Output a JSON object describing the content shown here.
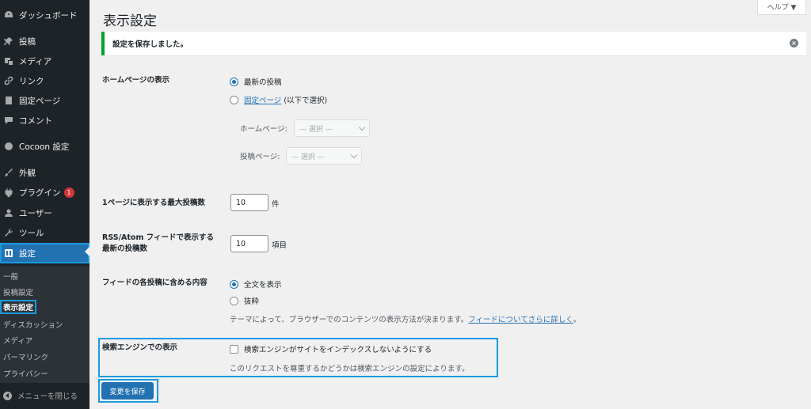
{
  "sidebar": {
    "items": [
      {
        "label": "ダッシュボード",
        "icon": "dashboard-icon"
      },
      {
        "label": "投稿",
        "icon": "pin-icon"
      },
      {
        "label": "メディア",
        "icon": "media-icon"
      },
      {
        "label": "リンク",
        "icon": "link-icon"
      },
      {
        "label": "固定ページ",
        "icon": "page-icon"
      },
      {
        "label": "コメント",
        "icon": "comment-icon"
      },
      {
        "label": "Cocoon 設定",
        "icon": "circle-icon"
      },
      {
        "label": "外観",
        "icon": "brush-icon"
      },
      {
        "label": "プラグイン",
        "icon": "plugin-icon",
        "badge": "1"
      },
      {
        "label": "ユーザー",
        "icon": "user-icon"
      },
      {
        "label": "ツール",
        "icon": "wrench-icon"
      },
      {
        "label": "設定",
        "icon": "settings-icon"
      }
    ],
    "submenu": [
      "一般",
      "投稿設定",
      "表示設定",
      "ディスカッション",
      "メディア",
      "パーマリンク",
      "プライバシー"
    ],
    "collapse_label": "メニューを閉じる"
  },
  "help_tab": "ヘルプ ▼",
  "page_title": "表示設定",
  "notice": {
    "text": "設定を保存しました。",
    "color": "#00a32a"
  },
  "homepage": {
    "label": "ホームページの表示",
    "option_latest": "最新の投稿",
    "option_static_link": "固定ページ",
    "option_static_suffix": " (以下で選択)",
    "homepage_select_label": "ホームページ:",
    "homepage_select_value": "— 選択 —",
    "posts_select_label": "投稿ページ:",
    "posts_select_value": "— 選択 —"
  },
  "posts_per_page": {
    "label": "1ページに表示する最大投稿数",
    "value": "10",
    "unit": "件"
  },
  "rss_items": {
    "label_line1": "RSS/Atom フィードで表示する",
    "label_line2": "最新の投稿数",
    "value": "10",
    "unit": "項目"
  },
  "feed_content": {
    "label": "フィードの各投稿に含める内容",
    "option_full": "全文を表示",
    "option_excerpt": "抜粋",
    "description": "テーマによって、ブラウザーでのコンテンツの表示方法が決まります。",
    "description_link": "フィードについてさらに詳しく",
    "description_end": "。"
  },
  "search_engine": {
    "label": "検索エンジンでの表示",
    "checkbox_label": "検索エンジンがサイトをインデックスしないようにする",
    "description": "このリクエストを尊重するかどうかは検索エンジンの設定によります。"
  },
  "save_button": "変更を保存",
  "colors": {
    "accent": "#2271b1",
    "sidebar": "#1d2327",
    "highlight": "#1a9ae0",
    "badge": "#d63638"
  }
}
